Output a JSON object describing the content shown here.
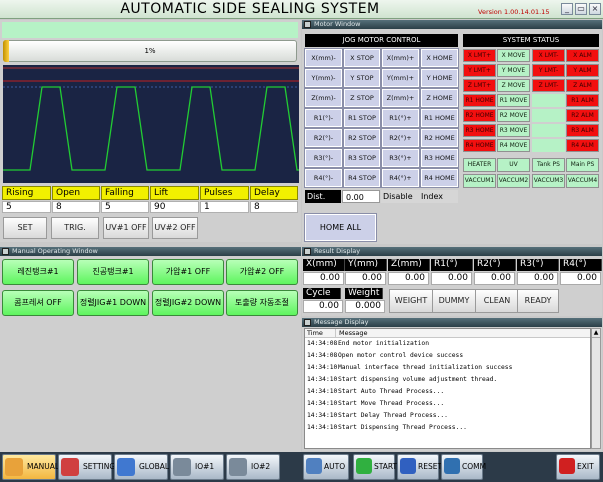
{
  "window": {
    "title": "AUTOMATIC SIDE SEALING SYSTEM",
    "version": "Version 1.00.14.01.15"
  },
  "progress": {
    "value_percent": 1,
    "label": "1%"
  },
  "params": {
    "headers": [
      "Rising",
      "Open",
      "Falling",
      "Lift",
      "Pulses",
      "Delay"
    ],
    "values": [
      "5",
      "8",
      "5",
      "90",
      "1",
      "8"
    ]
  },
  "graph_buttons": [
    "SET",
    "TRIG.",
    "UV#1 OFF",
    "UV#2 OFF"
  ],
  "motor_window": {
    "title": "Motor Window",
    "jog_title": "JOG MOTOR CONTROL",
    "jog_rows": [
      [
        "X(mm)-",
        "X STOP",
        "X(mm)+",
        "X HOME"
      ],
      [
        "Y(mm)-",
        "Y STOP",
        "Y(mm)+",
        "Y HOME"
      ],
      [
        "Z(mm)-",
        "Z STOP",
        "Z(mm)+",
        "Z HOME"
      ],
      [
        "R1(°)-",
        "R1 STOP",
        "R1(°)+",
        "R1 HOME"
      ],
      [
        "R2(°)-",
        "R2 STOP",
        "R2(°)+",
        "R2 HOME"
      ],
      [
        "R3(°)-",
        "R3 STOP",
        "R3(°)+",
        "R3 HOME"
      ],
      [
        "R4(°)-",
        "R4 STOP",
        "R4(°)+",
        "R4 HOME"
      ]
    ],
    "dist_label": "Dist.",
    "dist_value": "0.00",
    "disable_label": "Disable",
    "index_label": "Index",
    "home_all": "HOME ALL",
    "status_title": "SYSTEM STATUS",
    "status_rows": [
      [
        {
          "t": "X LMT+",
          "c": "red"
        },
        {
          "t": "X MOVE",
          "c": "grn"
        },
        {
          "t": "X LMT-",
          "c": "red"
        },
        {
          "t": "X ALM",
          "c": "red"
        }
      ],
      [
        {
          "t": "Y LMT+",
          "c": "red"
        },
        {
          "t": "Y MOVE",
          "c": "grn"
        },
        {
          "t": "Y LMT-",
          "c": "red"
        },
        {
          "t": "Y ALM",
          "c": "red"
        }
      ],
      [
        {
          "t": "Z LMT+",
          "c": "red"
        },
        {
          "t": "Z MOVE",
          "c": "grn"
        },
        {
          "t": "Z LMT-",
          "c": "red"
        },
        {
          "t": "Z ALM",
          "c": "red"
        }
      ],
      [
        {
          "t": "R1 HOME",
          "c": "red"
        },
        {
          "t": "R1 MOVE",
          "c": "grn"
        },
        {
          "t": "",
          "c": "blank"
        },
        {
          "t": "R1 ALM",
          "c": "red"
        }
      ],
      [
        {
          "t": "R2 HOME",
          "c": "red"
        },
        {
          "t": "R2 MOVE",
          "c": "grn"
        },
        {
          "t": "",
          "c": "blank"
        },
        {
          "t": "R2 ALM",
          "c": "red"
        }
      ],
      [
        {
          "t": "R3 HOME",
          "c": "red"
        },
        {
          "t": "R3 MOVE",
          "c": "grn"
        },
        {
          "t": "",
          "c": "blank"
        },
        {
          "t": "R3 ALM",
          "c": "red"
        }
      ],
      [
        {
          "t": "R4 HOME",
          "c": "red"
        },
        {
          "t": "R4 MOVE",
          "c": "grn"
        },
        {
          "t": "",
          "c": "blank"
        },
        {
          "t": "R4 ALM",
          "c": "red"
        }
      ]
    ],
    "io_rows": [
      [
        "HEATER",
        "UV",
        "Tank PS",
        "Main PS"
      ],
      [
        "VACCUM1",
        "VACCUM2",
        "VACCUM3",
        "VACCUM4"
      ]
    ]
  },
  "manual_window": {
    "title": "Manual Operating Window",
    "buttons": [
      [
        "레진탱크#1",
        "진공탱크#1",
        "가압#1 OFF",
        "가압#2 OFF"
      ],
      [
        "콤프레셔 OFF",
        "정렬JIG#1 DOWN",
        "정렬JIG#2 DOWN",
        "토출량 자동조절"
      ]
    ]
  },
  "result_display": {
    "title": "Result Display",
    "headers": [
      "X(mm)",
      "Y(mm)",
      "Z(mm)",
      "R1(°)",
      "R2(°)",
      "R3(°)",
      "R4(°)"
    ],
    "values": [
      "0.00",
      "0.00",
      "0.00",
      "0.00",
      "0.00",
      "0.00",
      "0.00"
    ],
    "cycle_label": "Cycle",
    "weight_label": "Weight",
    "cycle_value": "0.00",
    "weight_value": "0.000",
    "buttons": [
      "WEIGHT",
      "DUMMY",
      "CLEAN",
      "READY"
    ]
  },
  "message_display": {
    "title": "Message Display",
    "col_time": "Time",
    "col_message": "Message",
    "rows": [
      {
        "time": "14:34:08",
        "msg": "End motor initialization"
      },
      {
        "time": "14:34:08",
        "msg": "Open motor control device  success"
      },
      {
        "time": "14:34:10",
        "msg": "Manual interface thread initialization success"
      },
      {
        "time": "14:34:10",
        "msg": "Start dispensing volume adjustment thread."
      },
      {
        "time": "14:34:10",
        "msg": "Start Auto Thread Process..."
      },
      {
        "time": "14:34:10",
        "msg": "Start Move Thread Process..."
      },
      {
        "time": "14:34:10",
        "msg": "Start Delay Thread Process..."
      },
      {
        "time": "14:34:10",
        "msg": "Start Dispensing Thread Process..."
      }
    ]
  },
  "toolbar_left": [
    {
      "label": "MANUAL",
      "icon": "manual-icon"
    },
    {
      "label": "SETTING",
      "icon": "setting-icon"
    },
    {
      "label": "GLOBAL",
      "icon": "global-icon"
    },
    {
      "label": "IO#1",
      "icon": "io1-icon"
    },
    {
      "label": "IO#2",
      "icon": "io2-icon"
    }
  ],
  "toolbar_right": [
    {
      "label": "AUTO",
      "icon": "auto-icon"
    },
    {
      "label": "START",
      "icon": "start-icon"
    },
    {
      "label": "RESET",
      "icon": "reset-icon"
    },
    {
      "label": "COMM",
      "icon": "comm-icon"
    },
    {
      "label": "EXIT",
      "icon": "exit-icon"
    }
  ],
  "colors": {
    "status_red": "#f20f0f",
    "status_green": "#b6f2c6",
    "param_yellow": "#f2f000",
    "graph_bg": "#1a2444",
    "wave_green": "#22cc33"
  }
}
